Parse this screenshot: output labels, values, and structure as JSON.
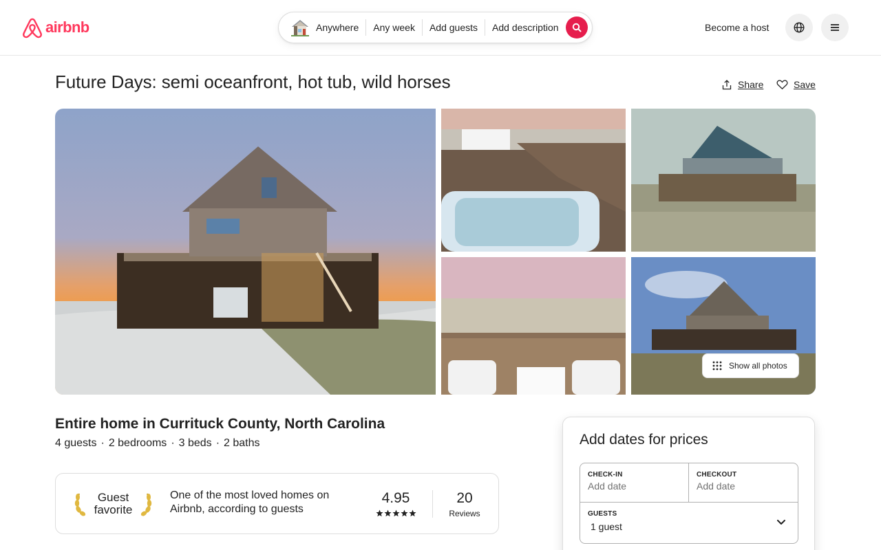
{
  "header": {
    "logo_text": "airbnb",
    "search": {
      "where": "Anywhere",
      "when": "Any week",
      "who": "Add guests",
      "description": "Add description"
    },
    "become_host": "Become a host",
    "icons": [
      "airbnb-logo-icon",
      "house-icon",
      "search-icon",
      "globe-icon",
      "hamburger-menu-icon"
    ]
  },
  "listing": {
    "title": "Future Days: semi oceanfront, hot tub, wild horses",
    "share_label": "Share",
    "save_label": "Save",
    "show_all_photos": "Show all photos",
    "subtitle": "Entire home in Currituck County, North Carolina",
    "details": [
      "4 guests",
      "2 bedrooms",
      "3 beds",
      "2 baths"
    ],
    "details_separator": "·"
  },
  "guest_favorite": {
    "label_line1": "Guest",
    "label_line2": "favorite",
    "description": "One of the most loved homes on Airbnb, according to guests",
    "rating": "4.95",
    "stars": 5,
    "reviews_count": "20",
    "reviews_label": "Reviews"
  },
  "booking": {
    "title": "Add dates for prices",
    "checkin_label": "CHECK-IN",
    "checkin_value": "Add date",
    "checkout_label": "CHECKOUT",
    "checkout_value": "Add date",
    "guests_label": "GUESTS",
    "guests_value": "1 guest"
  },
  "colors": {
    "brand": "#ff385c",
    "search_button": "#e61e4d",
    "text": "#222222",
    "muted": "#717171",
    "border": "#dddddd"
  }
}
